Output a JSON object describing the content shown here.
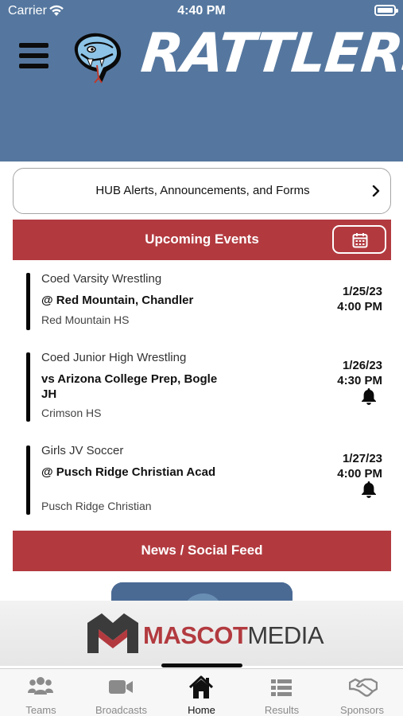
{
  "status_bar": {
    "carrier": "Carrier",
    "time": "4:40 PM"
  },
  "header": {
    "brand": "RATTLERS",
    "menu_icon": "hamburger-icon",
    "logo": "rattlesnake-logo",
    "background": "#55779f"
  },
  "alerts": {
    "label": "HUB Alerts, Announcements, and Forms",
    "icon": "chevron-right-icon"
  },
  "upcoming": {
    "title": "Upcoming Events",
    "calendar_icon": "calendar-icon",
    "accent": "#b23a3f"
  },
  "events": [
    {
      "sport": "Coed Varsity Wrestling",
      "opponent": "@ Red Mountain, Chandler",
      "location": "Red Mountain HS",
      "date": "1/25/23",
      "time": "4:00 PM",
      "bell": false
    },
    {
      "sport": "Coed Junior High Wrestling",
      "opponent": "vs Arizona College Prep, Bogle JH",
      "location": "Crimson HS",
      "date": "1/26/23",
      "time": "4:30 PM",
      "bell": true
    },
    {
      "sport": "Girls JV Soccer",
      "opponent": "@ Pusch Ridge Christian Acad",
      "location": "Pusch Ridge Christian",
      "date": "1/27/23",
      "time": "4:00 PM",
      "bell": true
    }
  ],
  "news": {
    "title": "News / Social Feed"
  },
  "sponsor": {
    "mascot": "MASCOT",
    "media": "MEDIA",
    "logo": "mascotmedia-logo"
  },
  "tabs": [
    {
      "label": "Teams",
      "icon": "teams-icon"
    },
    {
      "label": "Broadcasts",
      "icon": "video-camera-icon"
    },
    {
      "label": "Home",
      "icon": "home-icon",
      "active": true
    },
    {
      "label": "Results",
      "icon": "list-icon"
    },
    {
      "label": "Sponsors",
      "icon": "handshake-icon"
    }
  ]
}
